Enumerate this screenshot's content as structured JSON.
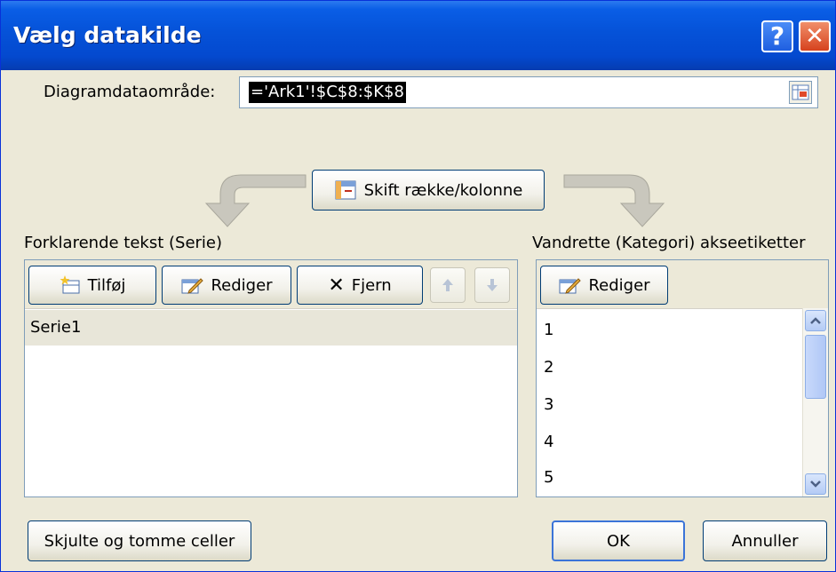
{
  "dialog": {
    "title": "Vælg datakilde",
    "help_label": "?",
    "close_label": "✕"
  },
  "range": {
    "label": "Diagramdataområde:",
    "value": "='Ark1'!$C$8:$K$8"
  },
  "switch_button": {
    "label": "Skift række/kolonne"
  },
  "series_panel": {
    "heading": "Forklarende tekst (Serie)",
    "add_label": "Tilføj",
    "edit_label": "Rediger",
    "remove_label": "Fjern",
    "items": [
      "Serie1"
    ]
  },
  "category_panel": {
    "heading": "Vandrette (Kategori) akseetiketter",
    "edit_label": "Rediger",
    "items": [
      "1",
      "2",
      "3",
      "4",
      "5"
    ]
  },
  "footer": {
    "hidden_cells_label": "Skjulte og tomme celler",
    "ok_label": "OK",
    "cancel_label": "Annuller"
  },
  "colors": {
    "title_bar": "#0552d8",
    "dialog_bg": "#ece9d8",
    "selection": "#e8e6d9"
  }
}
